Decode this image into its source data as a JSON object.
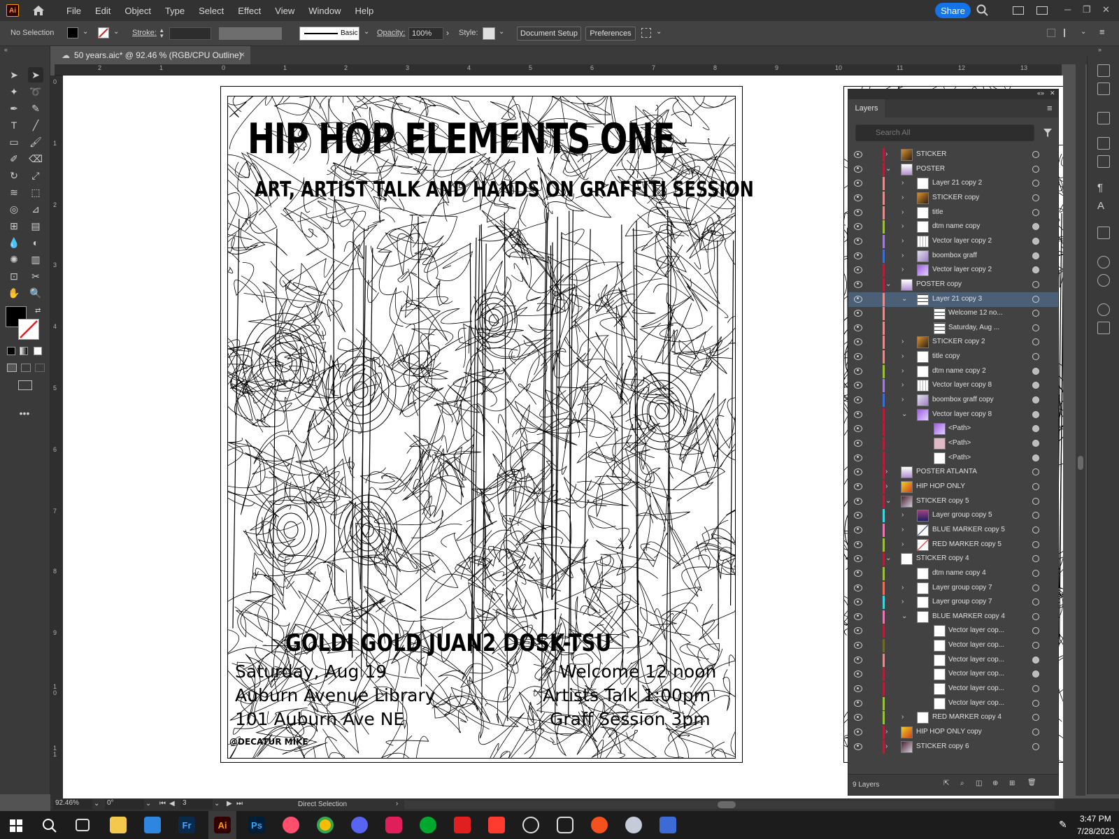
{
  "app": {
    "logo": "Ai",
    "home_icon": "home-icon"
  },
  "menu": [
    "File",
    "Edit",
    "Object",
    "Type",
    "Select",
    "Effect",
    "View",
    "Window",
    "Help"
  ],
  "share_label": "Share",
  "control": {
    "selection": "No Selection",
    "stroke_label": "Stroke:",
    "brush_label": "Basic",
    "opacity_label": "Opacity:",
    "opacity_value": "100%",
    "style_label": "Style:",
    "doc_setup": "Document Setup",
    "preferences": "Preferences"
  },
  "tab": {
    "title": "50 years.aic* @ 92.46 % (RGB/CPU Outline)",
    "close": "×"
  },
  "ruler": {
    "h": [
      "2",
      "1",
      "0",
      "1",
      "2",
      "3",
      "4",
      "5",
      "6",
      "7",
      "8",
      "9",
      "10",
      "11",
      "12",
      "13"
    ],
    "v": [
      "0",
      "1",
      "2",
      "3",
      "4",
      "5",
      "6",
      "7",
      "8",
      "9",
      "1\n0",
      "1\n1"
    ]
  },
  "poster": {
    "title": "HIP HOP ELEMENTS ONE",
    "subtitle": "ART, ARTIST TALK AND HANDS ON GRAFFITI SESSION",
    "artists": "GOLDI GOLD   JUAN2   DOSK-TSU",
    "left": [
      "Saturday, Aug 19",
      "Auburn Avenue Library",
      "101 Auburn Ave NE "
    ],
    "right": [
      "Welcome 12 noon",
      "Artists Talk 1:00pm",
      "Graff Session 3pm"
    ],
    "credit": "@DECATUR MIKE"
  },
  "layers": {
    "tab": "Layers",
    "search_placeholder": "Search All",
    "footer_count": "9 Layers",
    "rows": [
      {
        "name": "STICKER",
        "indent": 0,
        "tw": "›",
        "color": "#b0203a",
        "thumb": "sticker",
        "target": "o"
      },
      {
        "name": "POSTER",
        "indent": 0,
        "tw": "⌄",
        "color": "#b0203a",
        "thumb": "poster",
        "target": "o"
      },
      {
        "name": "Layer 21 copy 2",
        "indent": 1,
        "tw": "›",
        "color": "#e0908f",
        "thumb": "white",
        "target": "o"
      },
      {
        "name": "STICKER copy",
        "indent": 1,
        "tw": "›",
        "color": "#e0908f",
        "thumb": "sticker",
        "target": "o"
      },
      {
        "name": "title",
        "indent": 1,
        "tw": "›",
        "color": "#e0908f",
        "thumb": "white",
        "target": "o"
      },
      {
        "name": "dtm name copy",
        "indent": 1,
        "tw": "›",
        "color": "#9bc03c",
        "thumb": "white",
        "target": "f"
      },
      {
        "name": "Vector layer copy 2",
        "indent": 1,
        "tw": "›",
        "color": "#a07fd0",
        "thumb": "lines",
        "target": "f"
      },
      {
        "name": "boombox graff",
        "indent": 1,
        "tw": "›",
        "color": "#3a6ed0",
        "thumb": "boombox",
        "target": "f"
      },
      {
        "name": "Vector layer copy 2",
        "indent": 1,
        "tw": "›",
        "color": "#b0203a",
        "thumb": "purple",
        "target": "f"
      },
      {
        "name": "POSTER copy",
        "indent": 0,
        "tw": "⌄",
        "color": "#b0203a",
        "thumb": "poster",
        "target": "o"
      },
      {
        "name": "Layer 21 copy 3",
        "indent": 1,
        "tw": "⌄",
        "color": "#e0908f",
        "thumb": "text",
        "target": "o",
        "selected": true
      },
      {
        "name": "Welcome 12 no...",
        "indent": 2,
        "tw": "",
        "color": "#e0908f",
        "thumb": "text",
        "target": "o"
      },
      {
        "name": "Saturday, Aug ...",
        "indent": 2,
        "tw": "",
        "color": "#e0908f",
        "thumb": "text",
        "target": "o"
      },
      {
        "name": "STICKER copy 2",
        "indent": 1,
        "tw": "›",
        "color": "#e0908f",
        "thumb": "sticker",
        "target": "o"
      },
      {
        "name": "title copy",
        "indent": 1,
        "tw": "›",
        "color": "#e0908f",
        "thumb": "white",
        "target": "o"
      },
      {
        "name": "dtm name copy 2",
        "indent": 1,
        "tw": "›",
        "color": "#9bc03c",
        "thumb": "white",
        "target": "f"
      },
      {
        "name": "Vector layer copy 8",
        "indent": 1,
        "tw": "›",
        "color": "#a07fd0",
        "thumb": "lines",
        "target": "f"
      },
      {
        "name": "boombox graff copy",
        "indent": 1,
        "tw": "›",
        "color": "#3a6ed0",
        "thumb": "boombox",
        "target": "f"
      },
      {
        "name": "Vector layer copy 8",
        "indent": 1,
        "tw": "⌄",
        "color": "#b0203a",
        "thumb": "purple",
        "target": "f"
      },
      {
        "name": "<Path>",
        "indent": 2,
        "tw": "",
        "color": "#b0203a",
        "thumb": "purple",
        "target": "f"
      },
      {
        "name": "<Path>",
        "indent": 2,
        "tw": "",
        "color": "#b0203a",
        "thumb": "pink",
        "target": "f"
      },
      {
        "name": "<Path>",
        "indent": 2,
        "tw": "",
        "color": "#b0203a",
        "thumb": "white",
        "target": "f"
      },
      {
        "name": "POSTER ATLANTA",
        "indent": 0,
        "tw": "›",
        "color": "#b0203a",
        "thumb": "poster",
        "target": "o"
      },
      {
        "name": "HIP HOP ONLY",
        "indent": 0,
        "tw": "›",
        "color": "#b0203a",
        "thumb": "hiphop",
        "target": "o"
      },
      {
        "name": "STICKER copy 5",
        "indent": 0,
        "tw": "⌄",
        "color": "#b0203a",
        "thumb": "stickerx",
        "target": "o"
      },
      {
        "name": "Layer group copy 5",
        "indent": 1,
        "tw": "›",
        "color": "#3dd6e0",
        "thumb": "figure",
        "target": "o"
      },
      {
        "name": "BLUE MARKER copy 5",
        "indent": 1,
        "tw": "›",
        "color": "#e67ab0",
        "thumb": "marker",
        "target": "o"
      },
      {
        "name": "RED MARKER copy 5",
        "indent": 1,
        "tw": "›",
        "color": "#9bc03c",
        "thumb": "redmarker",
        "target": "o"
      },
      {
        "name": "STICKER copy 4",
        "indent": 0,
        "tw": "⌄",
        "color": "#b0203a",
        "thumb": "white",
        "target": "o"
      },
      {
        "name": "dtm name copy 4",
        "indent": 1,
        "tw": "",
        "color": "#9bc03c",
        "thumb": "white",
        "target": "o"
      },
      {
        "name": "Layer group copy 7",
        "indent": 1,
        "tw": "›",
        "color": "#e67060",
        "thumb": "white",
        "target": "o"
      },
      {
        "name": "Layer group copy 7",
        "indent": 1,
        "tw": "›",
        "color": "#3dd6e0",
        "thumb": "white",
        "target": "o"
      },
      {
        "name": "BLUE MARKER copy 4",
        "indent": 1,
        "tw": "⌄",
        "color": "#e67ab0",
        "thumb": "white",
        "target": "o"
      },
      {
        "name": "Vector layer cop...",
        "indent": 2,
        "tw": "",
        "color": "#b0203a",
        "thumb": "white",
        "target": "o"
      },
      {
        "name": "Vector layer cop...",
        "indent": 2,
        "tw": "",
        "color": "#6b6b2a",
        "thumb": "white",
        "target": "o"
      },
      {
        "name": "Vector layer cop...",
        "indent": 2,
        "tw": "",
        "color": "#e0908f",
        "thumb": "white",
        "target": "f"
      },
      {
        "name": "Vector layer cop...",
        "indent": 2,
        "tw": "",
        "color": "#b0203a",
        "thumb": "white",
        "target": "f"
      },
      {
        "name": "Vector layer cop...",
        "indent": 2,
        "tw": "",
        "color": "#b0203a",
        "thumb": "white",
        "target": "o"
      },
      {
        "name": "Vector layer cop...",
        "indent": 2,
        "tw": "",
        "color": "#9bc03c",
        "thumb": "white",
        "target": "o"
      },
      {
        "name": "RED MARKER copy 4",
        "indent": 1,
        "tw": "›",
        "color": "#9bc03c",
        "thumb": "white",
        "target": "o"
      },
      {
        "name": "HIP HOP ONLY copy",
        "indent": 0,
        "tw": "›",
        "color": "#b0203a",
        "thumb": "hiphop",
        "target": "o"
      },
      {
        "name": "STICKER copy 6",
        "indent": 0,
        "tw": "›",
        "color": "#b0203a",
        "thumb": "stickerx",
        "target": "o"
      }
    ]
  },
  "status": {
    "zoom": "92.46%",
    "rotation": "0°",
    "artboard": "3",
    "tool": "Direct Selection"
  },
  "clock": {
    "time": "3:47 PM",
    "date": "7/28/2023"
  },
  "colors": {
    "accent": "#1473e6",
    "selected_row": "#4b5f77"
  }
}
